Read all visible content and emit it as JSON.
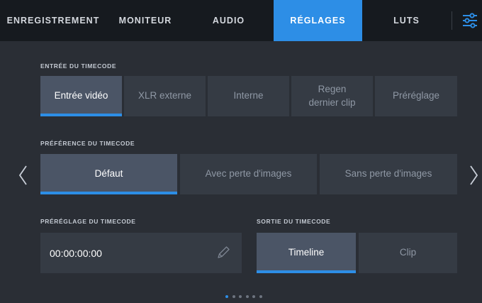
{
  "tabs": [
    {
      "label": "ENREGISTREMENT",
      "active": false
    },
    {
      "label": "MONITEUR",
      "active": false
    },
    {
      "label": "AUDIO",
      "active": false
    },
    {
      "label": "RÉGLAGES",
      "active": true
    },
    {
      "label": "LUTS",
      "active": false
    }
  ],
  "colors": {
    "accent": "#2d8ee6",
    "panel": "#2a2e35",
    "topbar": "#161a1f",
    "segment": "#353b44",
    "segment_selected": "#4b5566"
  },
  "timecode_input": {
    "label": "ENTRÉE DU TIMECODE",
    "options": [
      "Entrée vidéo",
      "XLR externe",
      "Interne",
      "Regen\ndernier clip",
      "Préréglage"
    ],
    "selected": "Entrée vidéo"
  },
  "timecode_preference": {
    "label": "PRÉFÉRENCE DU TIMECODE",
    "options": [
      "Défaut",
      "Avec perte d'images",
      "Sans perte d'images"
    ],
    "selected": "Défaut"
  },
  "timecode_preset": {
    "label": "PRÉRÉGLAGE DU TIMECODE",
    "value": "00:00:00:00",
    "edit_icon": "pencil-icon"
  },
  "timecode_output": {
    "label": "SORTIE DU TIMECODE",
    "options": [
      "Timeline",
      "Clip"
    ],
    "selected": "Timeline"
  },
  "navigation": {
    "prev_icon": "chevron-left-icon",
    "next_icon": "chevron-right-icon",
    "settings_icon": "settings-sliders-icon"
  },
  "pagination": {
    "page_count": 6,
    "current_page": 1
  }
}
